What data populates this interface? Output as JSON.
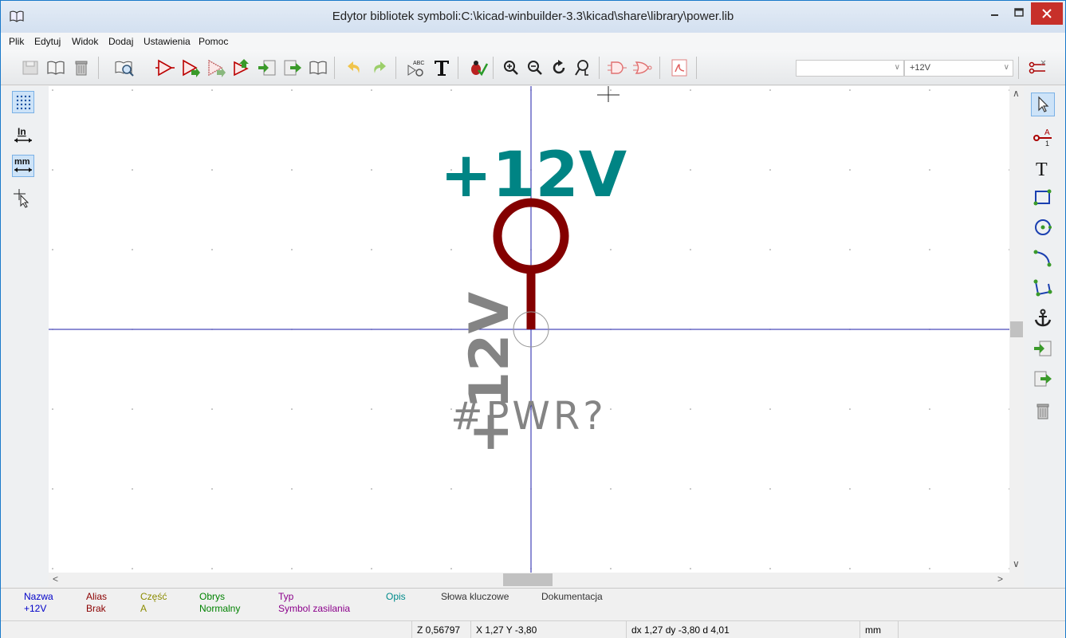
{
  "window": {
    "title": "Edytor bibliotek symboli:C:\\kicad-winbuilder-3.3\\kicad\\share\\library\\power.lib"
  },
  "menu": [
    "Plik",
    "Edytuj",
    "Widok",
    "Dodaj",
    "Ustawienia",
    "Pomoc"
  ],
  "toolbar": {
    "part_combo_value": "",
    "unit_combo_value": "+12V"
  },
  "left_toolbar": {
    "units_in": "In",
    "units_mm": "mm"
  },
  "right_toolbar": {
    "text_tool": "T"
  },
  "canvas": {
    "value_field": "+12V",
    "vertical_name": "+12V",
    "reference_field": "#PWR?"
  },
  "message_panel": {
    "columns": [
      {
        "label": "Nazwa",
        "value": "+12V",
        "label_color": "#0000c8",
        "value_color": "#0000c8"
      },
      {
        "label": "Alias",
        "value": "Brak",
        "label_color": "#8b0000",
        "value_color": "#8b0000"
      },
      {
        "label": "Część",
        "value": "A",
        "label_color": "#8b8b00",
        "value_color": "#8b8b00"
      },
      {
        "label": "Obrys",
        "value": "Normalny",
        "label_color": "#008200",
        "value_color": "#008200"
      },
      {
        "label": "Typ",
        "value": "Symbol zasilania",
        "label_color": "#8b008b",
        "value_color": "#8b008b"
      },
      {
        "label": "Opis",
        "value": "",
        "label_color": "#008b8b",
        "value_color": "#008b8b"
      },
      {
        "label": "Słowa kluczowe",
        "value": "",
        "label_color": "#333333",
        "value_color": "#333333"
      },
      {
        "label": "Dokumentacja",
        "value": "",
        "label_color": "#333333",
        "value_color": "#333333"
      }
    ]
  },
  "status": {
    "zoom": "Z 0,56797",
    "abs": "X 1,27  Y -3,80",
    "rel": "dx 1,27  dy -3,80  d 4,01",
    "units": "mm"
  },
  "colors": {
    "pin_body": "#840000",
    "value_text": "#008484",
    "field_text": "#848484",
    "axis": "#00008b"
  }
}
